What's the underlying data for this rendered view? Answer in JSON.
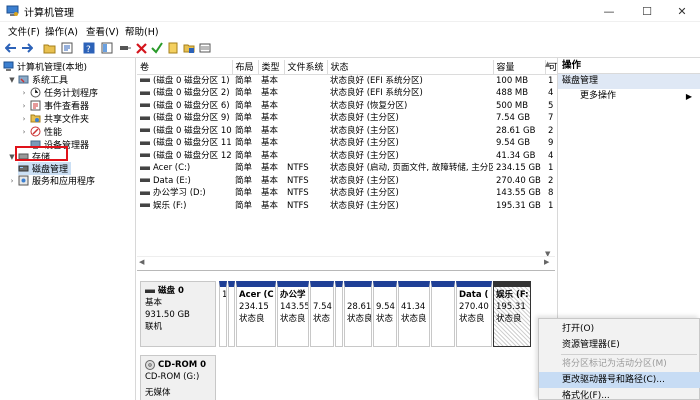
{
  "window": {
    "title": "计算机管理"
  },
  "menu": [
    "文件(F)",
    "操作(A)",
    "查看(V)",
    "帮助(H)"
  ],
  "tree": {
    "root": "计算机管理(本地)",
    "system_tools": "系统工具",
    "task_scheduler": "任务计划程序",
    "event_viewer": "事件查看器",
    "shared_folders": "共享文件夹",
    "performance": "性能",
    "device_manager": "设备管理器",
    "storage": "存储",
    "disk_management": "磁盘管理",
    "services": "服务和应用程序"
  },
  "volumes": {
    "columns": [
      "卷",
      "布局",
      "类型",
      "文件系统",
      "状态",
      "容量",
      "可"
    ],
    "rows": [
      [
        "(磁盘 0 磁盘分区 1)",
        "简单",
        "基本",
        "",
        "状态良好 (EFI 系统分区)",
        "100 MB",
        "1"
      ],
      [
        "(磁盘 0 磁盘分区 2)",
        "简单",
        "基本",
        "",
        "状态良好 (EFI 系统分区)",
        "488 MB",
        "4"
      ],
      [
        "(磁盘 0 磁盘分区 6)",
        "简单",
        "基本",
        "",
        "状态良好 (恢复分区)",
        "500 MB",
        "5"
      ],
      [
        "(磁盘 0 磁盘分区 9)",
        "简单",
        "基本",
        "",
        "状态良好 (主分区)",
        "7.54 GB",
        "7"
      ],
      [
        "(磁盘 0 磁盘分区 10)",
        "简单",
        "基本",
        "",
        "状态良好 (主分区)",
        "28.61 GB",
        "2"
      ],
      [
        "(磁盘 0 磁盘分区 11)",
        "简单",
        "基本",
        "",
        "状态良好 (主分区)",
        "9.54 GB",
        "9"
      ],
      [
        "(磁盘 0 磁盘分区 12)",
        "简单",
        "基本",
        "",
        "状态良好 (主分区)",
        "41.34 GB",
        "4"
      ],
      [
        "Acer (C:)",
        "简单",
        "基本",
        "NTFS",
        "状态良好 (启动, 页面文件, 故障转储, 主分区)",
        "234.15 GB",
        "1"
      ],
      [
        "Data (E:)",
        "简单",
        "基本",
        "NTFS",
        "状态良好 (主分区)",
        "270.40 GB",
        "2"
      ],
      [
        "办公学习 (D:)",
        "简单",
        "基本",
        "NTFS",
        "状态良好 (主分区)",
        "143.55 GB",
        "8"
      ],
      [
        "娱乐 (F:)",
        "简单",
        "基本",
        "NTFS",
        "状态良好 (主分区)",
        "195.31 GB",
        "1"
      ]
    ]
  },
  "disk0": {
    "name": "磁盘 0",
    "type": "基本",
    "size": "931.50 GB",
    "status": "联机"
  },
  "partitions": [
    {
      "name": "",
      "size": "1",
      "status": ""
    },
    {
      "name": "",
      "size": "",
      "status": ""
    },
    {
      "name": "Acer (C",
      "size": "234.15",
      "status": "状态良"
    },
    {
      "name": "办公学",
      "size": "143.55",
      "status": "状态良"
    },
    {
      "name": "",
      "size": "7.54",
      "status": "状态"
    },
    {
      "name": "",
      "size": "",
      "status": ""
    },
    {
      "name": "",
      "size": "28.61",
      "status": "状态良"
    },
    {
      "name": "",
      "size": "9.54",
      "status": "状态"
    },
    {
      "name": "",
      "size": "41.34",
      "status": "状态良"
    },
    {
      "name": "",
      "size": "",
      "status": ""
    },
    {
      "name": "Data (",
      "size": "270.40",
      "status": "状态良"
    },
    {
      "name": "娱乐 (F:",
      "size": "195.31",
      "status": "状态良"
    }
  ],
  "cdrom": {
    "name": "CD-ROM 0",
    "type": "CD-ROM (G:)",
    "media": "无媒体"
  },
  "actions": {
    "header": "操作",
    "section": "磁盘管理",
    "more": "更多操作"
  },
  "context_menu": {
    "open": "打开(O)",
    "explore": "资源管理器(E)",
    "mark_active": "将分区标记为活动分区(M)",
    "change_letter": "更改驱动器号和路径(C)...",
    "format": "格式化(F)..."
  },
  "colors": {
    "partition_bar": "#1f3f96",
    "highlight_box": "#e0121a",
    "menu_highlight": "#c7dcf4"
  }
}
